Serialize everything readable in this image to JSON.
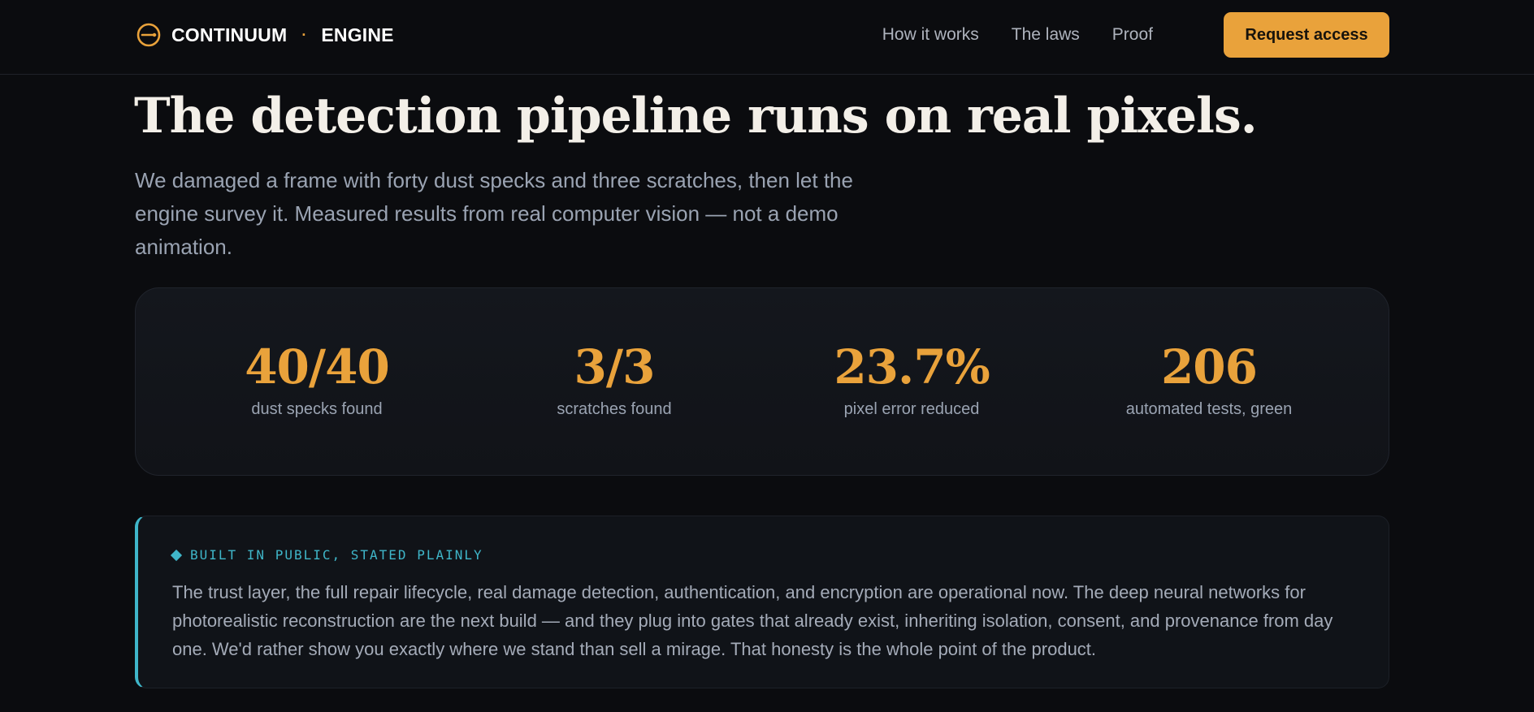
{
  "header": {
    "brand_name": "CONTINUUM",
    "brand_separator": "·",
    "brand_sub": "ENGINE",
    "nav": [
      {
        "label": "How it works"
      },
      {
        "label": "The laws"
      },
      {
        "label": "Proof"
      }
    ],
    "cta_label": "Request access"
  },
  "hero": {
    "title": "The detection pipeline runs on real pixels.",
    "lede": "We damaged a frame with forty dust specks and three scratches, then let the engine survey it. Measured results from real computer vision — not a demo animation."
  },
  "stats": [
    {
      "value": "40/40",
      "label": "dust specks found"
    },
    {
      "value": "3/3",
      "label": "scratches found"
    },
    {
      "value": "23.7%",
      "label": "pixel error reduced"
    },
    {
      "value": "206",
      "label": "automated tests, green"
    }
  ],
  "callout": {
    "eyebrow": "BUILT IN PUBLIC, STATED PLAINLY",
    "body": "The trust layer, the full repair lifecycle, real damage detection, authentication, and encryption are operational now. The deep neural networks for photorealistic reconstruction are the next build — and they plug into gates that already exist, inheriting isolation, consent, and provenance from day one. We'd rather show you exactly where we stand than sell a mirage. That honesty is the whole point of the product."
  },
  "colors": {
    "accent": "#e9a23b",
    "info": "#3fb6c9",
    "background": "#0b0c0f"
  },
  "icons": {
    "logo": "continuum-logo-icon",
    "eyebrow": "diamond-icon"
  }
}
